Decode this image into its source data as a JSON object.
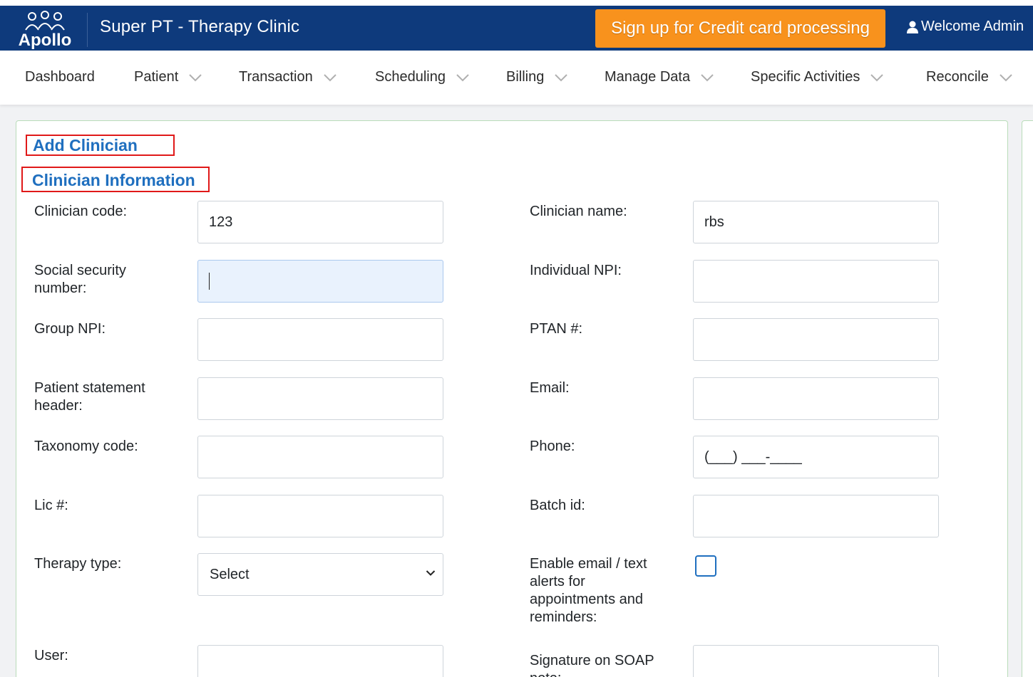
{
  "header": {
    "logo_text": "Apollo",
    "app_title": "Super PT - Therapy Clinic",
    "cc_button_label": "Sign up for Credit card processing",
    "welcome_text": "Welcome Admin",
    "brand_color": "#0e3a7c",
    "accent_color": "#f8921d"
  },
  "nav": {
    "items": [
      {
        "label": "Dashboard",
        "dropdown": false
      },
      {
        "label": "Patient",
        "dropdown": true
      },
      {
        "label": "Transaction",
        "dropdown": true
      },
      {
        "label": "Scheduling",
        "dropdown": true
      },
      {
        "label": "Billing",
        "dropdown": true
      },
      {
        "label": "Manage Data",
        "dropdown": true
      },
      {
        "label": "Specific Activities",
        "dropdown": true
      },
      {
        "label": "Reconcile",
        "dropdown": true
      }
    ]
  },
  "form": {
    "title": "Add Clinician",
    "section_title": "Clinician Information",
    "clinician_code": {
      "label": "Clinician code:",
      "value": "123"
    },
    "clinician_name": {
      "label": "Clinician name:",
      "value": "rbs"
    },
    "ssn": {
      "label_line1": "Social security",
      "label_line2": "number:",
      "value": ""
    },
    "individual_npi": {
      "label": "Individual NPI:",
      "value": ""
    },
    "group_npi": {
      "label": "Group NPI:",
      "value": ""
    },
    "ptan": {
      "label": "PTAN #:",
      "value": ""
    },
    "patient_statement_header": {
      "label_line1": "Patient statement",
      "label_line2": "header:",
      "value": ""
    },
    "email": {
      "label": "Email:",
      "value": ""
    },
    "taxonomy_code": {
      "label": "Taxonomy code:",
      "value": ""
    },
    "phone": {
      "label": "Phone:",
      "value": "(___) ___-____"
    },
    "lic": {
      "label": "Lic #:",
      "value": ""
    },
    "batch_id": {
      "label": "Batch id:",
      "value": ""
    },
    "therapy_type": {
      "label": "Therapy type:",
      "selected": "Select"
    },
    "enable_alerts": {
      "label_line1": "Enable email / text",
      "label_line2": "alerts for",
      "label_line3": "appointments and",
      "label_line4": "reminders:",
      "checked": false
    },
    "user": {
      "label": "User:",
      "value": ""
    },
    "signature_soap": {
      "label_line1": "Signature on SOAP",
      "label_line2": "note:",
      "value": ""
    }
  }
}
